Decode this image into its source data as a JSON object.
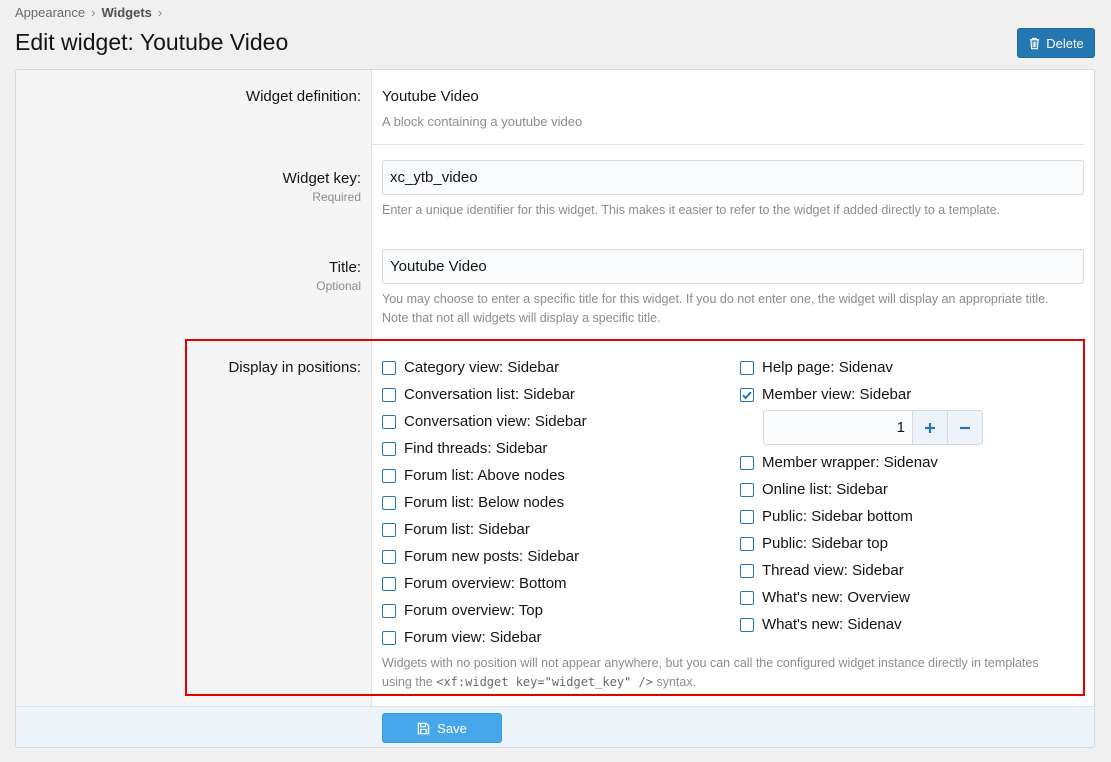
{
  "breadcrumb": {
    "parent": "Appearance",
    "current": "Widgets"
  },
  "page_title": "Edit widget: Youtube Video",
  "actions": {
    "delete_label": "Delete"
  },
  "form": {
    "definition": {
      "label": "Widget definition:",
      "value": "Youtube Video",
      "description": "A block containing a youtube video"
    },
    "widget_key": {
      "label": "Widget key:",
      "sublabel": "Required",
      "value": "xc_ytb_video",
      "hint": "Enter a unique identifier for this widget. This makes it easier to refer to the widget if added directly to a template."
    },
    "title": {
      "label": "Title:",
      "sublabel": "Optional",
      "value": "Youtube Video",
      "hint_line1": "You may choose to enter a specific title for this widget. If you do not enter one, the widget will display an appropriate title.",
      "hint_line2": "Note that not all widgets will display a specific title."
    },
    "positions": {
      "label": "Display in positions:",
      "left": [
        {
          "label": "Category view: Sidebar",
          "checked": false
        },
        {
          "label": "Conversation list: Sidebar",
          "checked": false
        },
        {
          "label": "Conversation view: Sidebar",
          "checked": false
        },
        {
          "label": "Find threads: Sidebar",
          "checked": false
        },
        {
          "label": "Forum list: Above nodes",
          "checked": false
        },
        {
          "label": "Forum list: Below nodes",
          "checked": false
        },
        {
          "label": "Forum list: Sidebar",
          "checked": false
        },
        {
          "label": "Forum new posts: Sidebar",
          "checked": false
        },
        {
          "label": "Forum overview: Bottom",
          "checked": false
        },
        {
          "label": "Forum overview: Top",
          "checked": false
        },
        {
          "label": "Forum view: Sidebar",
          "checked": false
        }
      ],
      "right_top": [
        {
          "label": "Help page: Sidenav",
          "checked": false
        },
        {
          "label": "Member view: Sidebar",
          "checked": true
        }
      ],
      "order_value": "1",
      "right_bottom": [
        {
          "label": "Member wrapper: Sidenav",
          "checked": false
        },
        {
          "label": "Online list: Sidebar",
          "checked": false
        },
        {
          "label": "Public: Sidebar bottom",
          "checked": false
        },
        {
          "label": "Public: Sidebar top",
          "checked": false
        },
        {
          "label": "Thread view: Sidebar",
          "checked": false
        },
        {
          "label": "What's new: Overview",
          "checked": false
        },
        {
          "label": "What's new: Sidenav",
          "checked": false
        }
      ],
      "hint_line1": "Widgets with no position will not appear anywhere, but you can call the configured widget instance directly in templates",
      "hint_prefix": "using the",
      "hint_code": "<xf:widget key=\"widget_key\" />",
      "hint_suffix": "syntax."
    }
  },
  "footer": {
    "save_label": "Save"
  },
  "colors": {
    "accent": "#2577b1",
    "save": "#47a7eb",
    "highlight": "#e60000"
  }
}
